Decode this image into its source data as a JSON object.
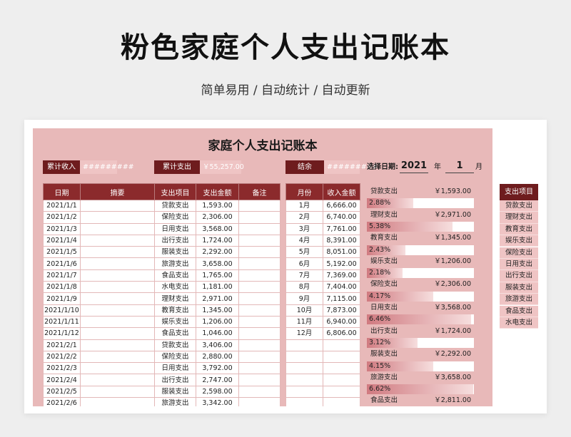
{
  "page": {
    "title": "粉色家庭个人支出记账本",
    "subtitle": "简单易用 / 自动统计 / 自动更新"
  },
  "sheet": {
    "title": "家庭个人支出记账本",
    "summary": {
      "income_label": "累计收入",
      "income_value": "#########",
      "expense_label": "累计支出",
      "expense_value": "￥55,257.00",
      "balance_label": "结余",
      "balance_value": "#########"
    },
    "date_select": {
      "label": "选择日期:",
      "year": "2021",
      "year_unit": "年",
      "month": "1",
      "month_unit": "月"
    },
    "expense_table": {
      "headers": [
        "日期",
        "摘要",
        "支出项目",
        "支出金额",
        "备注"
      ],
      "rows": [
        [
          "2021/1/1",
          "",
          "贷款支出",
          "1,593.00",
          ""
        ],
        [
          "2021/1/2",
          "",
          "保险支出",
          "2,306.00",
          ""
        ],
        [
          "2021/1/3",
          "",
          "日用支出",
          "3,568.00",
          ""
        ],
        [
          "2021/1/4",
          "",
          "出行支出",
          "1,724.00",
          ""
        ],
        [
          "2021/1/5",
          "",
          "服装支出",
          "2,292.00",
          ""
        ],
        [
          "2021/1/6",
          "",
          "旅游支出",
          "3,658.00",
          ""
        ],
        [
          "2021/1/7",
          "",
          "食品支出",
          "1,765.00",
          ""
        ],
        [
          "2021/1/8",
          "",
          "水电支出",
          "1,181.00",
          ""
        ],
        [
          "2021/1/9",
          "",
          "理财支出",
          "2,971.00",
          ""
        ],
        [
          "2021/1/10",
          "",
          "教育支出",
          "1,345.00",
          ""
        ],
        [
          "2021/1/11",
          "",
          "娱乐支出",
          "1,206.00",
          ""
        ],
        [
          "2021/1/12",
          "",
          "食品支出",
          "1,046.00",
          ""
        ],
        [
          "2021/2/1",
          "",
          "贷款支出",
          "3,406.00",
          ""
        ],
        [
          "2021/2/2",
          "",
          "保险支出",
          "2,880.00",
          ""
        ],
        [
          "2021/2/3",
          "",
          "日用支出",
          "3,792.00",
          ""
        ],
        [
          "2021/2/4",
          "",
          "出行支出",
          "2,747.00",
          ""
        ],
        [
          "2021/2/5",
          "",
          "服装支出",
          "2,598.00",
          ""
        ],
        [
          "2021/2/6",
          "",
          "旅游支出",
          "3,342.00",
          ""
        ]
      ]
    },
    "income_table": {
      "headers": [
        "月份",
        "收入金额"
      ],
      "rows": [
        [
          "1月",
          "6,666.00"
        ],
        [
          "2月",
          "6,740.00"
        ],
        [
          "3月",
          "7,761.00"
        ],
        [
          "4月",
          "8,391.00"
        ],
        [
          "5月",
          "8,051.00"
        ],
        [
          "6月",
          "5,192.00"
        ],
        [
          "7月",
          "7,369.00"
        ],
        [
          "8月",
          "7,404.00"
        ],
        [
          "9月",
          "7,115.00"
        ],
        [
          "10月",
          "7,873.00"
        ],
        [
          "11月",
          "6,940.00"
        ],
        [
          "12月",
          "6,806.00"
        ],
        [
          "",
          ""
        ],
        [
          "",
          ""
        ],
        [
          "",
          ""
        ],
        [
          "",
          ""
        ],
        [
          "",
          ""
        ],
        [
          "",
          ""
        ]
      ]
    },
    "stats": [
      {
        "name": "贷款支出",
        "amount": "￥1,593.00",
        "pct": "2.88%",
        "frac": 0.43
      },
      {
        "name": "理财支出",
        "amount": "￥2,971.00",
        "pct": "5.38%",
        "frac": 0.8
      },
      {
        "name": "教育支出",
        "amount": "￥1,345.00",
        "pct": "2.43%",
        "frac": 0.36
      },
      {
        "name": "娱乐支出",
        "amount": "￥1,206.00",
        "pct": "2.18%",
        "frac": 0.33
      },
      {
        "name": "保险支出",
        "amount": "￥2,306.00",
        "pct": "4.17%",
        "frac": 0.62
      },
      {
        "name": "日用支出",
        "amount": "￥3,568.00",
        "pct": "6.46%",
        "frac": 0.97
      },
      {
        "name": "出行支出",
        "amount": "￥1,724.00",
        "pct": "3.12%",
        "frac": 0.47
      },
      {
        "name": "服装支出",
        "amount": "￥2,292.00",
        "pct": "4.15%",
        "frac": 0.62
      },
      {
        "name": "旅游支出",
        "amount": "￥3,658.00",
        "pct": "6.62%",
        "frac": 0.99
      },
      {
        "name": "食品支出",
        "amount": "￥2,811.00",
        "pct": "",
        "frac": 0
      }
    ],
    "categories": {
      "header": "支出项目",
      "items": [
        "贷款支出",
        "理财支出",
        "教育支出",
        "娱乐支出",
        "保险支出",
        "日用支出",
        "出行支出",
        "服装支出",
        "旅游支出",
        "食品支出",
        "水电支出"
      ]
    }
  }
}
